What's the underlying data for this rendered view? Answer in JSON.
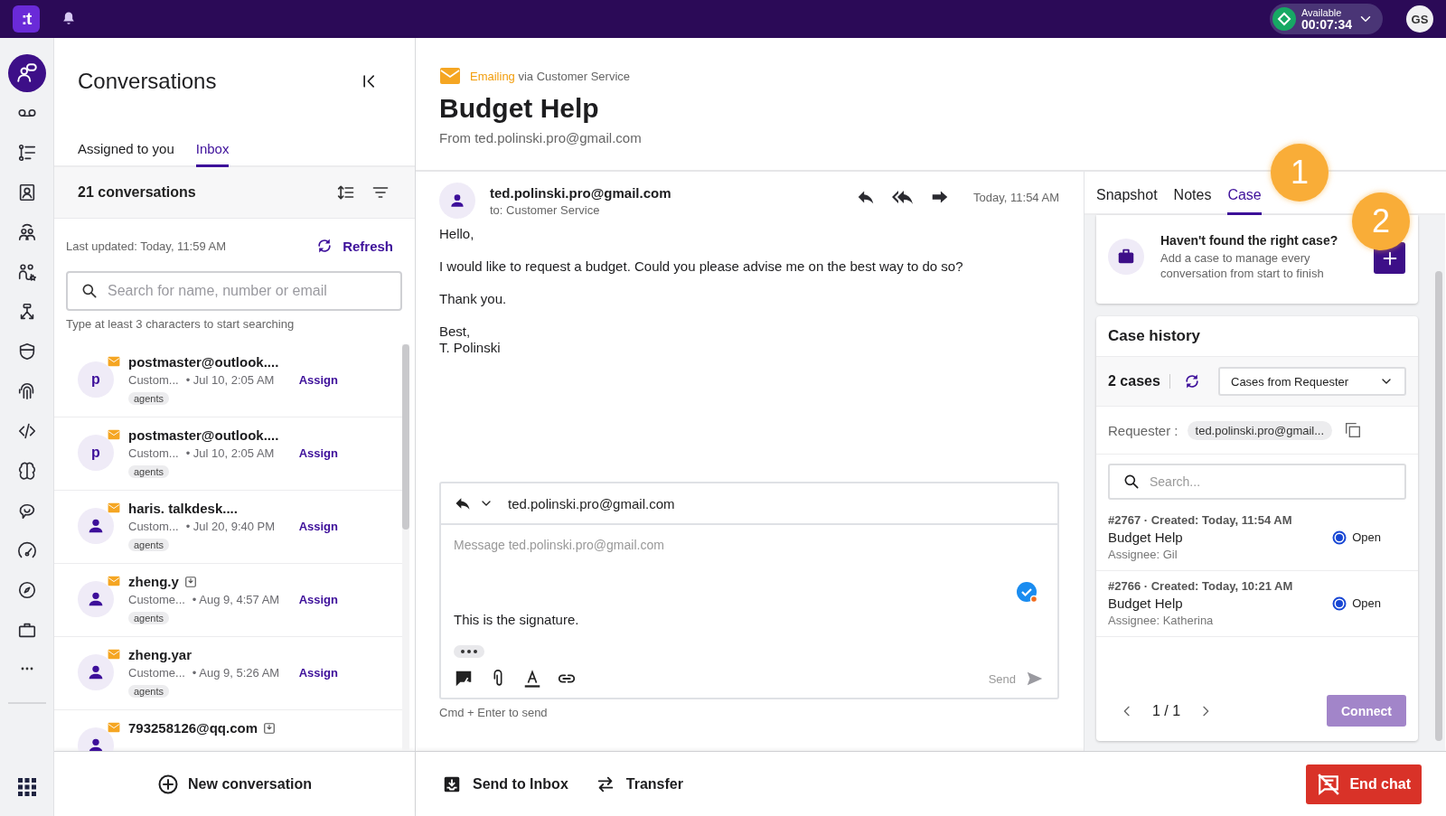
{
  "topbar": {
    "logo": ":t",
    "status": {
      "label": "Available",
      "timer": "00:07:34"
    },
    "avatar": "GS"
  },
  "rail": {
    "items": [
      {
        "selected": true
      },
      {
        "selected": false
      },
      {
        "selected": false
      },
      {
        "selected": false
      },
      {
        "selected": false
      },
      {
        "selected": false
      },
      {
        "selected": false
      },
      {
        "selected": false
      },
      {
        "selected": false
      },
      {
        "selected": false
      },
      {
        "selected": false
      },
      {
        "selected": false
      },
      {
        "selected": false
      },
      {
        "selected": false
      },
      {
        "selected": false
      }
    ]
  },
  "conversations": {
    "title": "Conversations",
    "tabs": [
      {
        "label": "Assigned to you",
        "selected": false
      },
      {
        "label": "Inbox",
        "selected": true
      }
    ],
    "count": "21 conversations",
    "last_updated": "Last updated: Today, 11:59 AM",
    "refresh": "Refresh",
    "search": {
      "placeholder": "Search for name, number or email"
    },
    "search_hint": "Type at least 3 characters to start searching",
    "items": [
      {
        "kind": "letter",
        "avatar": "p",
        "name": "postmaster@outlook....",
        "channel": "Custom...",
        "time": "• Jul 10, 2:05 AM",
        "action": "Assign",
        "tag": "agents",
        "inbox_icon": false
      },
      {
        "kind": "letter",
        "avatar": "p",
        "name": "postmaster@outlook....",
        "channel": "Custom...",
        "time": "• Jul 10, 2:05 AM",
        "action": "Assign",
        "tag": "agents",
        "inbox_icon": false
      },
      {
        "kind": "person",
        "name": "haris. talkdesk....",
        "channel": "Custom...",
        "time": "• Jul 20, 9:40 PM",
        "action": "Assign",
        "tag": "agents",
        "inbox_icon": false
      },
      {
        "kind": "person",
        "name": "zheng.y",
        "channel": "Custome...",
        "time": "• Aug 9, 4:57 AM",
        "action": "Assign",
        "tag": "agents",
        "inbox_icon": true
      },
      {
        "kind": "person",
        "name": "zheng.yar",
        "channel": "Custome...",
        "time": "• Aug 9, 5:26 AM",
        "action": "Assign",
        "tag": "agents",
        "inbox_icon": false
      },
      {
        "kind": "person",
        "name": "793258126@qq.com",
        "inbox_icon": true
      }
    ],
    "new_conversation": "New conversation"
  },
  "mail": {
    "channel": "Emailing",
    "via": "via Customer Service",
    "subject": "Budget Help",
    "from": "From ted.polinski.pro@gmail.com",
    "message": {
      "sender": "ted.polinski.pro@gmail.com",
      "to": "to: Customer Service",
      "time": "Today, 11:54 AM",
      "body": [
        [
          "Hello,"
        ],
        [
          "I would like to request a budget. Could you please advise me on the best way to do so?"
        ],
        [
          "Thank you."
        ],
        [
          "Best,",
          "T. Polinski"
        ]
      ]
    },
    "composer": {
      "recipient": "ted.polinski.pro@gmail.com",
      "placeholder": "Message ted.polinski.pro@gmail.com",
      "signature": "This is the signature.",
      "send": "Send",
      "send_disabled": true,
      "hint": "Cmd + Enter to send"
    }
  },
  "actions": {
    "send_to_inbox": "Send to Inbox",
    "transfer": "Transfer",
    "end_chat": "End chat"
  },
  "case_panel": {
    "tabs": [
      {
        "label": "Snapshot",
        "selected": false
      },
      {
        "label": "Notes",
        "selected": false
      },
      {
        "label": "Case",
        "selected": true
      }
    ],
    "prompt": {
      "title": "Haven't found the right case?",
      "text": "Add a case to manage every conversation from start to finish"
    },
    "history": {
      "title": "Case history",
      "count": "2 cases",
      "filter": "Cases from Requester",
      "requester_label": "Requester :",
      "requester": "ted.polinski.pro@gmail...",
      "search": {
        "placeholder": "Search..."
      },
      "cases": [
        {
          "meta": "#2767 · Created: Today, 11:54 AM",
          "title": "Budget Help",
          "assignee": "Assignee: Gil",
          "status": "Open",
          "selected": true
        },
        {
          "meta": "#2766 · Created: Today, 10:21 AM",
          "title": "Budget Help",
          "assignee": "Assignee: Katherina",
          "status": "Open",
          "selected": true
        }
      ],
      "page": "1 / 1",
      "connect": "Connect",
      "connect_disabled": true
    }
  },
  "annotations": [
    {
      "label": "1"
    },
    {
      "label": "2"
    }
  ]
}
